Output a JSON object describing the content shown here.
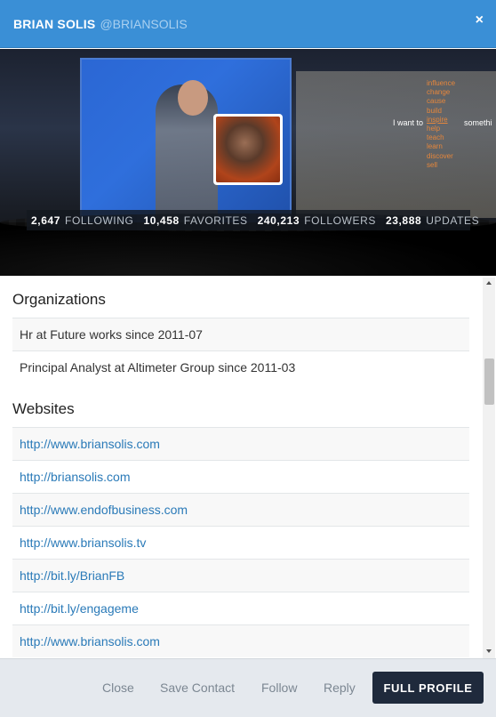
{
  "header": {
    "name": "BRIAN SOLIS",
    "handle": "@BRIANSOLIS",
    "close_label": "×"
  },
  "banner": {
    "slide_words": [
      "influence",
      "change",
      "cause",
      "build",
      "inspire",
      "help",
      "teach",
      "learn",
      "discover",
      "sell"
    ],
    "slide_phrase": "I want to",
    "slide_trailing": "somethi"
  },
  "stats": [
    {
      "value": "2,647",
      "label": "FOLLOWING"
    },
    {
      "value": "10,458",
      "label": "FAVORITES"
    },
    {
      "value": "240,213",
      "label": "FOLLOWERS"
    },
    {
      "value": "23,888",
      "label": "UPDATES"
    }
  ],
  "organizations": {
    "title": "Organizations",
    "items": [
      "Hr at Future works since 2011-07",
      "Principal Analyst at Altimeter Group since 2011-03"
    ]
  },
  "websites": {
    "title": "Websites",
    "items": [
      "http://www.briansolis.com",
      "http://briansolis.com",
      "http://www.endofbusiness.com",
      "http://www.briansolis.tv",
      "http://bit.ly/BrianFB",
      "http://bit.ly/engageme",
      "http://www.briansolis.com"
    ]
  },
  "footer": {
    "close": "Close",
    "save_contact": "Save Contact",
    "follow": "Follow",
    "reply": "Reply",
    "full_profile": "FULL PROFILE"
  },
  "colors": {
    "header_bg": "#3a8fd6",
    "link": "#2a7ab8",
    "primary_button": "#1f2a3c",
    "footer_bg": "#e5e9ee"
  }
}
